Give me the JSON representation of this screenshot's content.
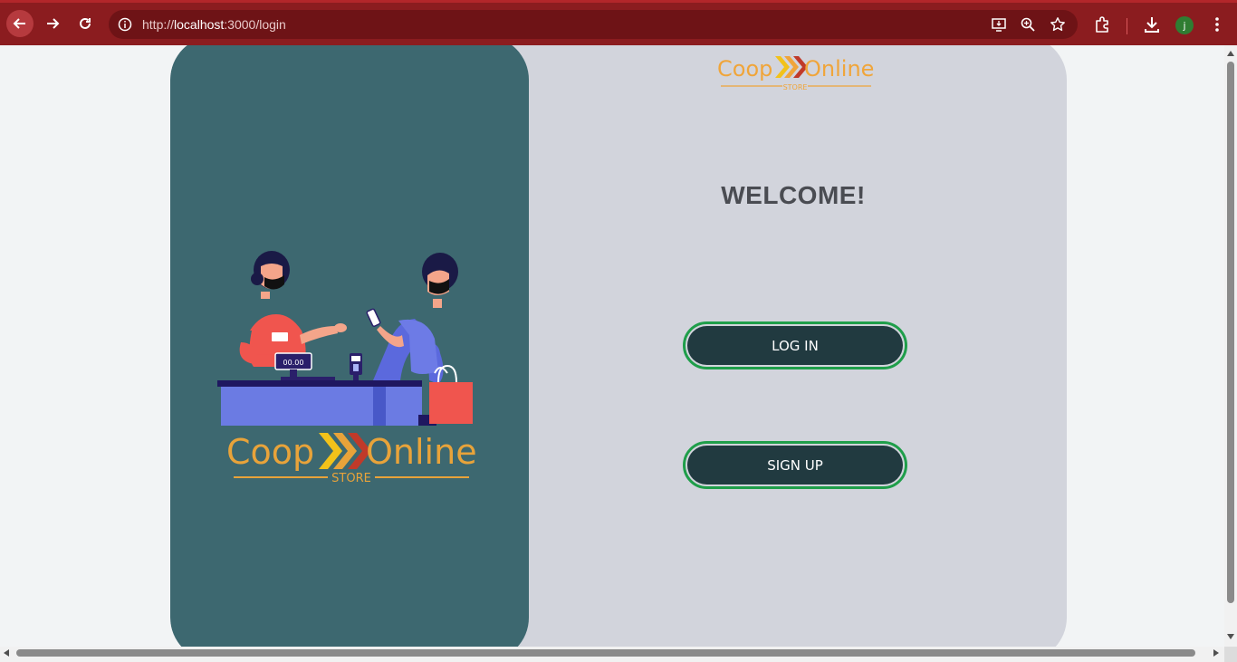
{
  "browser": {
    "url_prefix": "http://",
    "url_host": "localhost",
    "url_path": ":3000/login",
    "avatar_initial": "j",
    "icons": [
      "back-arrow-icon",
      "forward-arrow-icon",
      "reload-icon",
      "site-info-icon",
      "install-app-icon",
      "zoom-icon",
      "bookmark-star-icon",
      "extensions-icon",
      "download-icon",
      "kebab-menu-icon"
    ]
  },
  "logo": {
    "word1": "Coop",
    "word2": "Online",
    "sub": "STORE"
  },
  "illustration": {
    "register_display": "00.00",
    "name_tag": "—"
  },
  "main": {
    "welcome": "WELCOME!",
    "login_label": "LOG IN",
    "signup_label": "SIGN UP"
  },
  "colors": {
    "chrome": "#8b1c1f",
    "left_panel": "#3d6870",
    "card": "#d2d4dc",
    "button": "#213a40",
    "button_border": "#1f9e4a",
    "logo_orange": "#e8a33a"
  }
}
